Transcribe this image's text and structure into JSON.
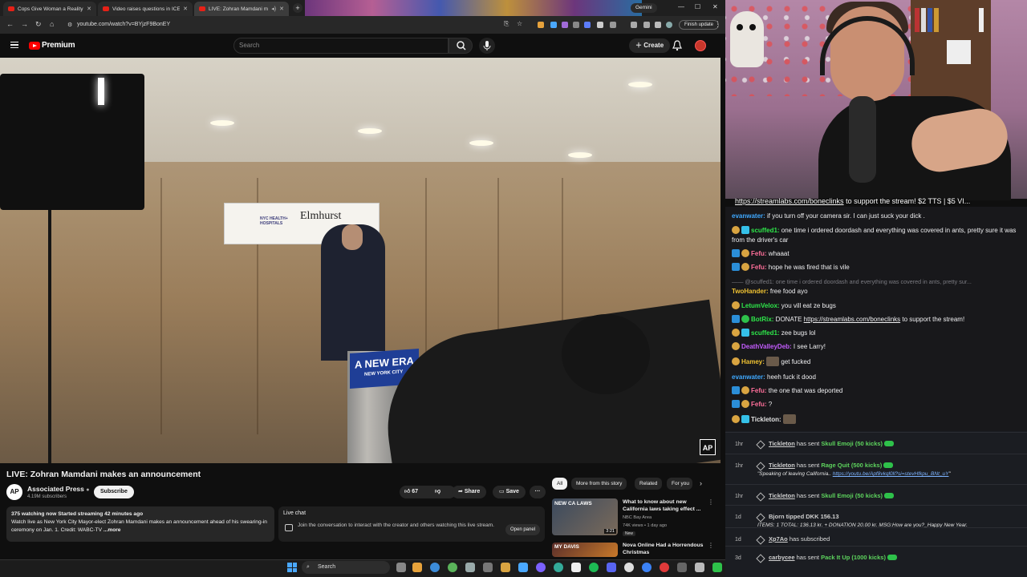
{
  "browser": {
    "tabs": [
      {
        "title": "Cops Give Woman a Reality Ch"
      },
      {
        "title": "Video raises questions in ICE sh"
      },
      {
        "title": "LIVE: Zohran Mamdani ma"
      }
    ],
    "gemini_label": "Gemini",
    "url": "youtube.com/watch?v=BYjzF9BonEY",
    "finish_update": "Finish update"
  },
  "youtube": {
    "brand": "Premium",
    "search_placeholder": "Search",
    "create_label": "Create",
    "video": {
      "sign_org": "NYC HEALTH+ HOSPITALS",
      "sign_name": "Elmhurst",
      "podium_title": "A NEW ERA",
      "podium_sub": "NEW YORK CITY",
      "ap_bug": "AP"
    },
    "title": "LIVE: Zohran Mamdani makes an announcement",
    "channel": {
      "avatar": "AP",
      "name": "Associated Press",
      "subscribers": "4.19M subscribers",
      "subscribe": "Subscribe"
    },
    "actions": {
      "likes": "67",
      "share": "Share",
      "save": "Save",
      "more": "···"
    },
    "description": {
      "stats": "375 watching now  Started streaming 42 minutes ago",
      "text": "Watch live as New York City Mayor-elect Zohran Mamdani makes an announcement ahead of his swearing-in ceremony on Jan. 1. Credit: WABC-TV",
      "more": "...more"
    },
    "live_chat": {
      "title": "Live chat",
      "prompt": "Join the conversation to interact with the creator and others watching this live stream.",
      "open_panel": "Open panel"
    },
    "chips": [
      "All",
      "More from this story",
      "Related",
      "For you"
    ],
    "recommendations": [
      {
        "thumb_text": "NEW CA LAWS",
        "duration": "3:21",
        "title": "What to know about new California laws taking effect ...",
        "channel": "NBC Bay Area",
        "meta": "74K views • 1 day ago",
        "badge": "New"
      },
      {
        "thumb_text": "MY DAVIS",
        "title": "Nova Online Had a Horrendous Christmas"
      }
    ]
  },
  "taskbar": {
    "search": "Search"
  },
  "stream": {
    "overlay_link": "https://streamlabs.com/boneclinks",
    "overlay_rest": " to support the stream! $2 TTS | $5 VI..."
  },
  "chat": [
    {
      "user": "evanwater:",
      "color": "#3fa9ff",
      "badges": [],
      "text": " if you turn off your camera sir. I can just suck your dick ."
    },
    {
      "user": "scuffed1:",
      "color": "#2ee84a",
      "badges": [
        "gold",
        "cyan"
      ],
      "text": " one time i ordered doordash and everything was covered in ants, pretty sure it was from the driver's car"
    },
    {
      "user": "Fefu:",
      "color": "#ff6f9a",
      "badges": [
        "blue",
        "gold"
      ],
      "text": " whaaat"
    },
    {
      "user": "Fefu:",
      "color": "#ff6f9a",
      "badges": [
        "blue",
        "gold"
      ],
      "text": " hope he was fired that is vile"
    },
    {
      "muted": "—— @scuffed1: one time i ordered doordash and everything was covered in ants, pretty sur..."
    },
    {
      "user": "TwoHander:",
      "color": "#f0c232",
      "badges": [],
      "text": " free food ayo"
    },
    {
      "user": "LetumVelox:",
      "color": "#2ee84a",
      "badges": [
        "gold"
      ],
      "text": " you vill eat ze bugs"
    },
    {
      "user": "BotRix:",
      "color": "#2ee84a",
      "badges": [
        "blue",
        "green"
      ],
      "text": " DONATE ",
      "link": "https://streamlabs.com/boneclinks",
      "after": " to support the stream!"
    },
    {
      "user": "scuffed1:",
      "color": "#2ee84a",
      "badges": [
        "gold",
        "cyan"
      ],
      "text": " zee bugs lol"
    },
    {
      "user": "DeathValleyDeb:",
      "color": "#c45cff",
      "badges": [
        "gold"
      ],
      "text": " I see Larry!"
    },
    {
      "user": "Hamey:",
      "color": "#f0c232",
      "badges": [
        "gold"
      ],
      "text": " get fucked",
      "emote": true
    },
    {
      "user": "evanwater:",
      "color": "#3fa9ff",
      "badges": [],
      "text": " heeh fuck it dood"
    },
    {
      "user": "Fefu:",
      "color": "#ff6f9a",
      "badges": [
        "blue",
        "gold"
      ],
      "text": " the one that was deported"
    },
    {
      "user": "Fefu:",
      "color": "#ff6f9a",
      "badges": [
        "blue",
        "gold"
      ],
      "text": " ?"
    },
    {
      "user": "Tickleton:",
      "color": "#e0e0e0",
      "badges": [
        "gold",
        "cyan"
      ],
      "text": "",
      "emote": true
    }
  ],
  "events": [
    {
      "time": "1hr",
      "who": "Tickleton",
      "mid": " has sent ",
      "item": "Skull Emoji (50 kicks)",
      "sub": ""
    },
    {
      "time": "1hr",
      "who": "Tickleton",
      "mid": " has sent ",
      "item": "Rage Quit (500 kicks)",
      "sub": "\"Speaking of leaving California.. ",
      "sub_link": "https://youtu.be/Apf8vkql0ll?si=stevHfkpu_BNt_uY",
      "sub_end": "\""
    },
    {
      "time": "1hr",
      "who": "Tickleton",
      "mid": " has sent ",
      "item": "Skull Emoji (50 kicks)",
      "sub": ""
    },
    {
      "time": "1d",
      "plain": "Bjorn tipped DKK 156.13",
      "sub": "ITEMS: 1 TOTAL: 136.13 kr. + DONATION 20.00 kr. MSG:How are you?_Happy New Year."
    },
    {
      "time": "1d",
      "who": "Xp7Ao",
      "mid": " has subscribed",
      "item": "",
      "sub": ""
    },
    {
      "time": "3d",
      "who": "carbycee",
      "mid": " has sent ",
      "item": "Pack It Up (1000 kicks)",
      "sub": ""
    }
  ],
  "colors": {
    "yt_red": "#ff0000",
    "kick_green": "#5dd35d",
    "chat_bg": "#18181b"
  }
}
